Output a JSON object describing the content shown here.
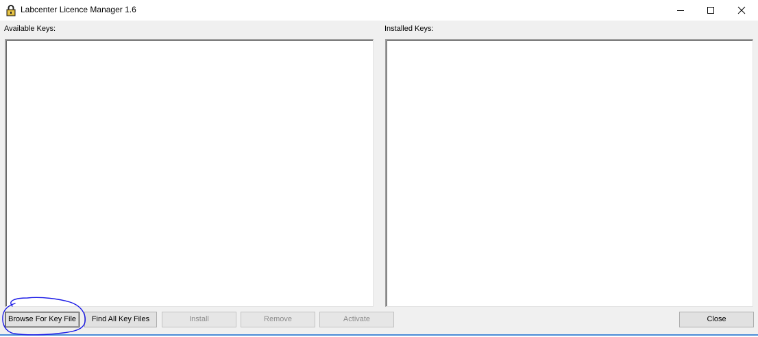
{
  "window": {
    "title": "Labcenter Licence Manager 1.6"
  },
  "panels": {
    "available": {
      "label": "Available Keys:",
      "items": []
    },
    "installed": {
      "label": "Installed Keys:",
      "items": []
    }
  },
  "buttons": {
    "browse": "Browse For Key File",
    "find_all": "Find All Key Files",
    "install": "Install",
    "remove": "Remove",
    "activate": "Activate",
    "close": "Close"
  },
  "colors": {
    "annotation": "#1a1ae6",
    "window_bg": "#f0f0f0",
    "accent_line": "#4a8bd6"
  },
  "icons": {
    "app": "padlock-icon",
    "minimize": "minimize-icon",
    "maximize": "maximize-icon",
    "close": "close-icon"
  }
}
